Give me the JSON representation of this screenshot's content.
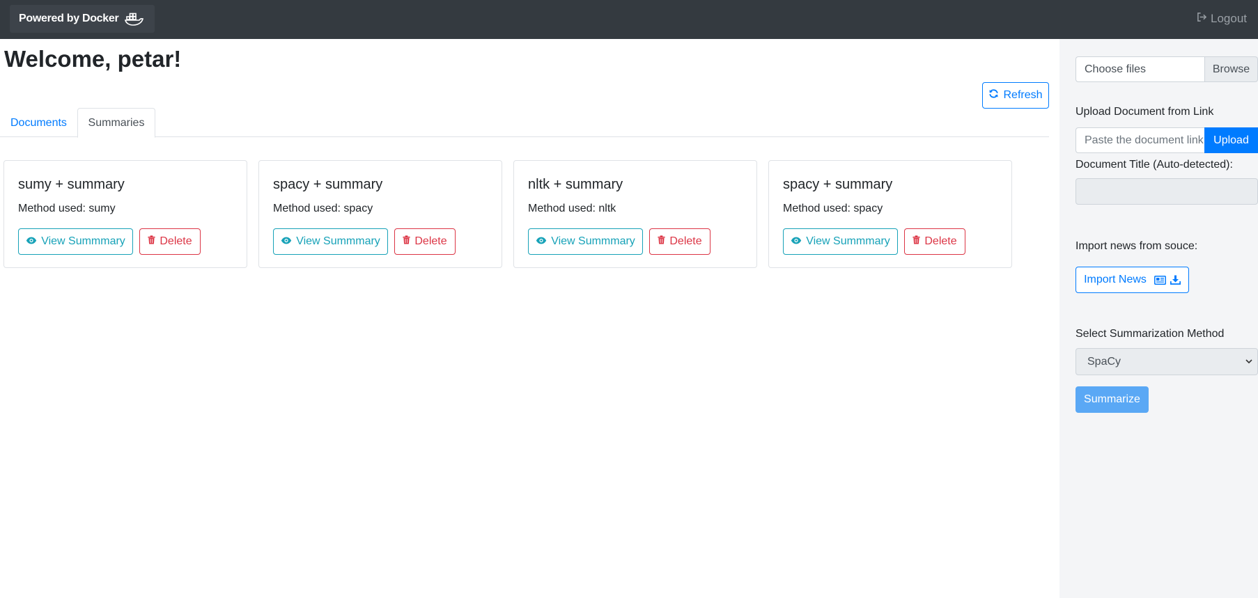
{
  "navbar": {
    "brand": "Powered by Docker",
    "brand_icon": "docker-whale-icon",
    "logout_label": "Logout",
    "logout_icon": "sign-out-icon"
  },
  "main": {
    "title": "Welcome, petar!",
    "refresh_label": "Refresh",
    "refresh_icon": "refresh-icon",
    "tabs": [
      {
        "label": "Documents",
        "active": false
      },
      {
        "label": "Summaries",
        "active": true
      }
    ],
    "cards": [
      {
        "title": "sumy + summary",
        "method": "Method used: sumy",
        "view_label": "View Summmary",
        "delete_label": "Delete"
      },
      {
        "title": "spacy + summary",
        "method": "Method used: spacy",
        "view_label": "View Summmary",
        "delete_label": "Delete"
      },
      {
        "title": "nltk + summary",
        "method": "Method used: nltk",
        "view_label": "View Summmary",
        "delete_label": "Delete"
      },
      {
        "title": "spacy + summary",
        "method": "Method used: spacy",
        "view_label": "View Summmary",
        "delete_label": "Delete"
      }
    ]
  },
  "sidebar": {
    "file_label": "Choose files",
    "browse_label": "Browse",
    "upload_link_label": "Upload Document from Link",
    "link_placeholder": "Paste the document link",
    "upload_label": "Upload",
    "doc_title_label": "Document Title (Auto-detected):",
    "doc_title_value": "",
    "import_label": "Import news from souce:",
    "import_button_label": "Import News",
    "select_label": "Select Summarization Method",
    "selected_method": "SpaCy",
    "summarize_label": "Summarize"
  },
  "colors": {
    "navbar_bg": "#343a40",
    "primary": "#007bff",
    "info": "#17a2b8",
    "danger": "#dc3545",
    "summarize_bg": "#5aa8f5",
    "sidebar_bg": "#f4f5f7"
  }
}
